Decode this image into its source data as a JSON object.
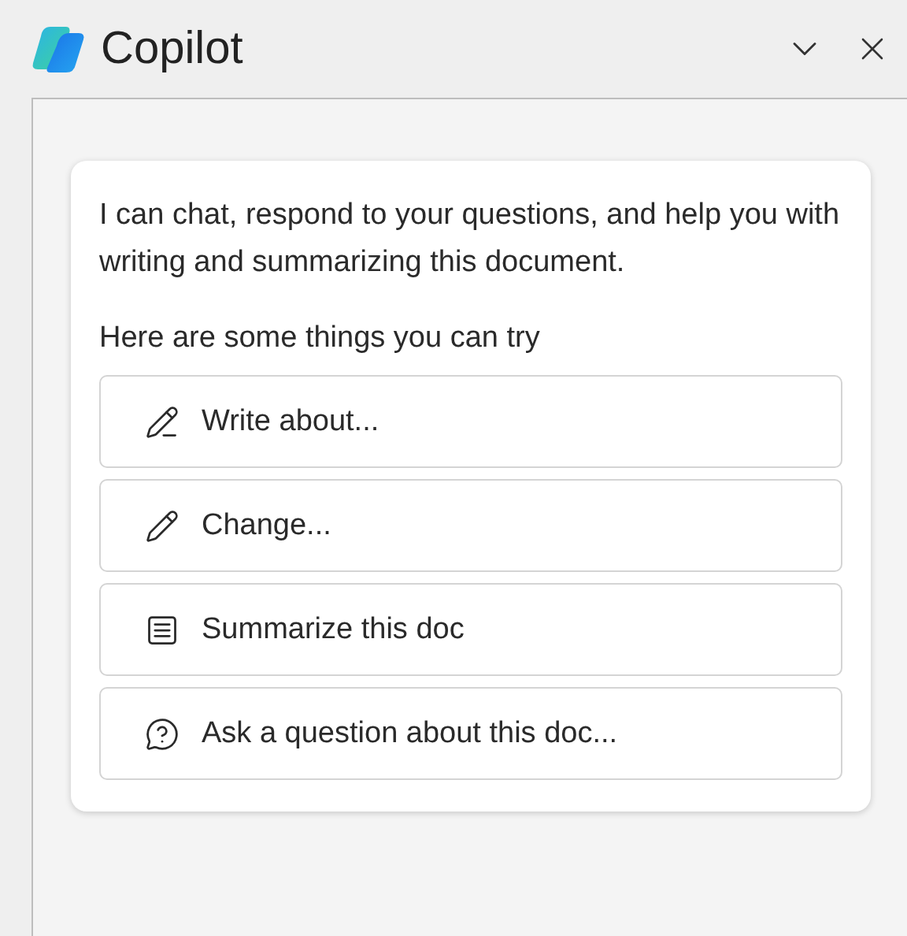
{
  "header": {
    "title": "Copilot"
  },
  "card": {
    "intro": "I can chat, respond to your questions, and help you with writing and summarizing this document.",
    "prompt": "Here are some things you can try",
    "suggestions": [
      {
        "kind": "write",
        "label": "Write about..."
      },
      {
        "kind": "change",
        "label": "Change..."
      },
      {
        "kind": "summarize",
        "label": "Summarize this doc"
      },
      {
        "kind": "ask",
        "label": "Ask a question about this doc..."
      }
    ]
  }
}
